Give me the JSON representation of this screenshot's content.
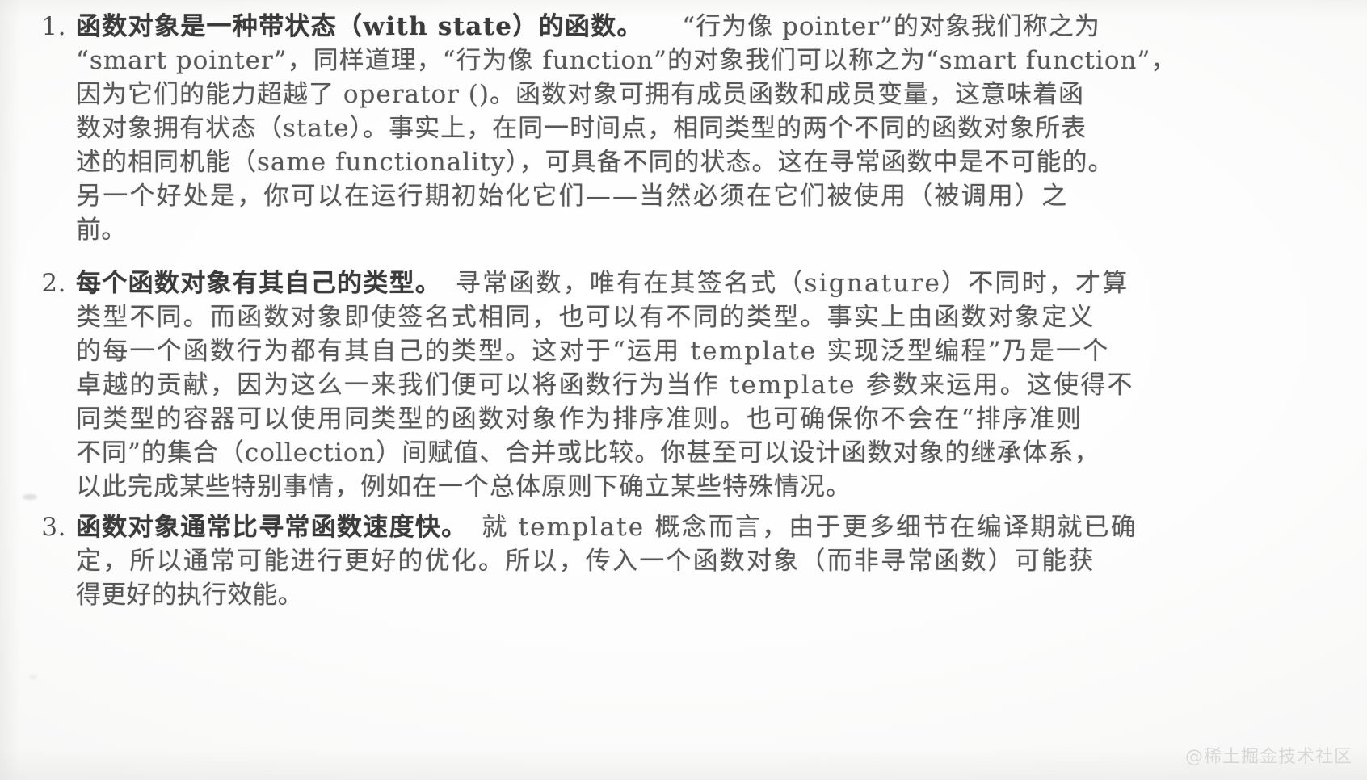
{
  "page": {
    "kind": "scanned-book-page",
    "language": "zh-CN",
    "background_color": "#ffffff",
    "text_color": "#585858",
    "bold_text_color": "#3b3b3b",
    "watermark_color": "#d8d8d8"
  },
  "watermark": {
    "text": "@稀土掘金技术社区"
  },
  "list": [
    {
      "marker": "1.",
      "bold_lead": "函数对象是一种带状态（with state）的函数。",
      "body": "“行为像 pointer”的对象我们称之为“smart pointer”，同样道理，“行为像 function”的对象我们可以称之为“smart function”，因为它们的能力超越了 operator ()。函数对象可拥有成员函数和成员变量，这意味着函数对象拥有状态（state）。事实上，在同一时间点，相同类型的两个不同的函数对象所表述的相同机能（same functionality），可具备不同的状态。这在寻常函数中是不可能的。另一个好处是，你可以在运行期初始化它们——当然必须在它们被使用（被调用）之前。",
      "rendered_lines": [
        [
          {
            "t": "函数对象是一种带状态（with state）的函数。",
            "bold": true
          },
          {
            "t": "　　“行为像 pointer”的对象我们称之为",
            "bold": false
          }
        ],
        [
          {
            "t": "“smart pointer”，同样道理，“行为像 function”的对象我们可以称之为“smart function”，",
            "bold": false
          }
        ],
        [
          {
            "t": "因为它们的能力超越了 operator ()。函数对象可拥有成员函数和成员变量，这意味着函",
            "bold": false
          }
        ],
        [
          {
            "t": "数对象拥有状态（state）。事实上，在同一时间点，相同类型的两个不同的函数对象所表",
            "bold": false
          }
        ],
        [
          {
            "t": "述的相同机能（same functionality），可具备不同的状态。这在寻常函数中是不可能的。",
            "bold": false
          }
        ],
        [
          {
            "t": "另一个好处是，你可以在运行期初始化它们——当然必须在它们被使用（被调用）之",
            "bold": false
          }
        ],
        [
          {
            "t": "前。",
            "bold": false
          }
        ]
      ]
    },
    {
      "marker": "2.",
      "bold_lead": "每个函数对象有其自己的类型。",
      "body": "寻常函数，唯有在其签名式（signature）不同时，才算类型不同。而函数对象即使签名式相同，也可以有不同的类型。事实上由函数对象定义的每一个函数行为都有其自己的类型。这对于“运用 template 实现泛型编程”乃是一个卓越的贡献，因为这么一来我们便可以将函数行为当作 template 参数来运用。这使得不同类型的容器可以使用同类型的函数对象作为排序准则。也可确保你不会在“排序准则不同”的集合（collection）间赋值、合并或比较。你甚至可以设计函数对象的继承体系，以此完成某些特别事情，例如在一个总体原则下确立某些特殊情况。",
      "rendered_lines": [
        [
          {
            "t": "每个函数对象有其自己的类型。",
            "bold": true
          },
          {
            "t": "　寻常函数，唯有在其签名式（signature）不同时，才算",
            "bold": false
          }
        ],
        [
          {
            "t": "类型不同。而函数对象即使签名式相同，也可以有不同的类型。事实上由函数对象定义",
            "bold": false
          }
        ],
        [
          {
            "t": "的每一个函数行为都有其自己的类型。这对于“运用 template 实现泛型编程”乃是一个",
            "bold": false
          }
        ],
        [
          {
            "t": "卓越的贡献，因为这么一来我们便可以将函数行为当作 template 参数来运用。这使得不",
            "bold": false
          }
        ],
        [
          {
            "t": "同类型的容器可以使用同类型的函数对象作为排序准则。也可确保你不会在“排序准则",
            "bold": false
          }
        ],
        [
          {
            "t": "不同”的集合（collection）间赋值、合并或比较。你甚至可以设计函数对象的继承体系，",
            "bold": false
          }
        ],
        [
          {
            "t": "以此完成某些特别事情，例如在一个总体原则下确立某些特殊情况。",
            "bold": false
          }
        ]
      ]
    },
    {
      "marker": "3.",
      "bold_lead": "函数对象通常比寻常函数速度快。",
      "body": "就 template 概念而言，由于更多细节在编译期就已确定，所以通常可能进行更好的优化。所以，传入一个函数对象（而非寻常函数）可能获得更好的执行效能。",
      "rendered_lines": [
        [
          {
            "t": "函数对象通常比寻常函数速度快。",
            "bold": true
          },
          {
            "t": "　就 template 概念而言，由于更多细节在编译期就已确",
            "bold": false
          }
        ],
        [
          {
            "t": "定，所以通常可能进行更好的优化。所以，传入一个函数对象（而非寻常函数）可能获",
            "bold": false
          }
        ],
        [
          {
            "t": "得更好的执行效能。",
            "bold": false
          }
        ]
      ]
    }
  ]
}
